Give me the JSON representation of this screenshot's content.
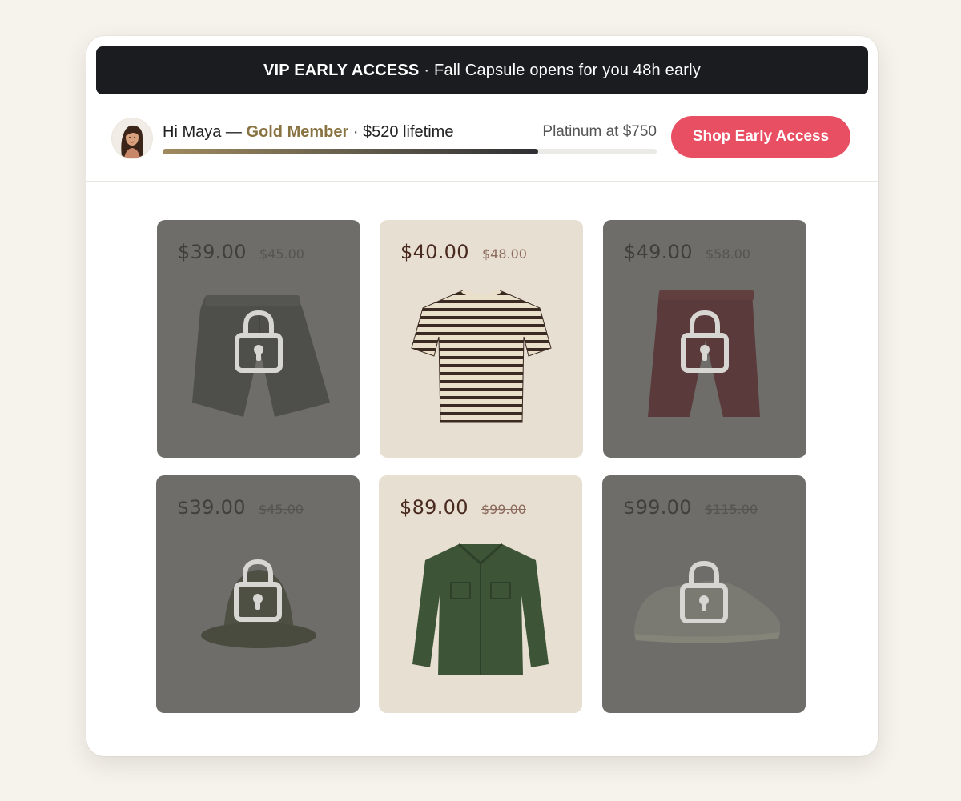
{
  "banner": {
    "strong": "VIP EARLY ACCESS",
    "rest": "· Fall Capsule opens for you 48h early"
  },
  "member": {
    "greeting": "Hi Maya —",
    "tier": "Gold Member",
    "lifetime": "· $520 lifetime",
    "next_tier": "Platinum at $750",
    "progress_fraction": 0.76,
    "cta_label": "Shop Early Access",
    "accent_color": "#e94f63",
    "tier_color": "#8a7343"
  },
  "products": [
    {
      "price": "$39.00",
      "original": "$45.00",
      "item": "shorts",
      "locked": true
    },
    {
      "price": "$40.00",
      "original": "$48.00",
      "item": "striped-tshirt",
      "locked": false
    },
    {
      "price": "$49.00",
      "original": "$58.00",
      "item": "pants",
      "locked": true
    },
    {
      "price": "$39.00",
      "original": "$45.00",
      "item": "bucket-hat",
      "locked": true
    },
    {
      "price": "$89.00",
      "original": "$99.00",
      "item": "overshirt",
      "locked": false
    },
    {
      "price": "$99.00",
      "original": "$115.00",
      "item": "sneaker",
      "locked": true
    }
  ]
}
